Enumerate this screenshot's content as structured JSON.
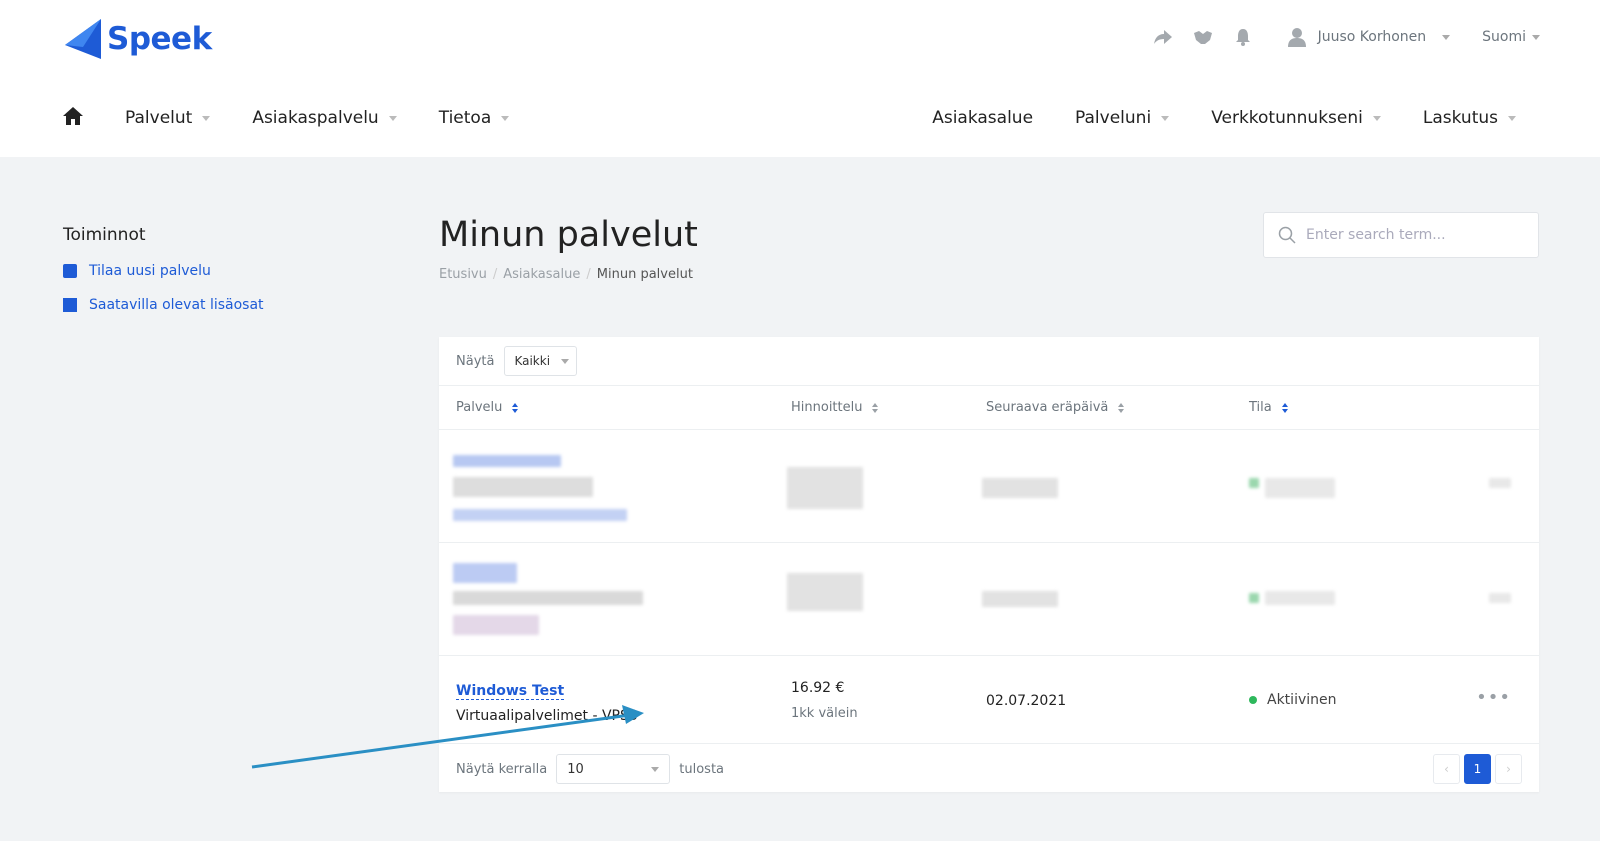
{
  "brand": {
    "name": "Speek",
    "color": "#1e5bd6"
  },
  "topbar": {
    "icons": [
      "share-icon",
      "handshake-icon",
      "bell-icon",
      "user-icon"
    ],
    "user_name": "Juuso Korhonen",
    "language": "Suomi"
  },
  "nav": {
    "left": [
      {
        "label": "Palvelut",
        "dropdown": true
      },
      {
        "label": "Asiakaspalvelu",
        "dropdown": true
      },
      {
        "label": "Tietoa",
        "dropdown": true
      }
    ],
    "right": [
      {
        "label": "Asiakasalue",
        "dropdown": false
      },
      {
        "label": "Palveluni",
        "dropdown": true
      },
      {
        "label": "Verkkotunnukseni",
        "dropdown": true
      },
      {
        "label": "Laskutus",
        "dropdown": true
      }
    ]
  },
  "sidebar": {
    "title": "Toiminnot",
    "links": [
      {
        "label": "Tilaa uusi palvelu",
        "icon": "cart-icon"
      },
      {
        "label": "Saatavilla olevat lisäosat",
        "icon": "addons-icon"
      }
    ]
  },
  "page": {
    "title": "Minun palvelut",
    "breadcrumb": [
      "Etusivu",
      "Asiakasalue",
      "Minun palvelut"
    ],
    "search_placeholder": "Enter search term..."
  },
  "table": {
    "show_label": "Näytä",
    "show_value": "Kaikki",
    "columns": [
      "Palvelu",
      "Hinnoittelu",
      "Seuraava eräpäivä",
      "Tila"
    ],
    "rows": [
      {
        "name": "Windows Test",
        "product": "Virtuaalipalvelimet - VPS3",
        "price": "16.92 €",
        "cycle": "1kk välein",
        "next_due": "02.07.2021",
        "status": "Aktiivinen",
        "actions": "•••"
      }
    ],
    "footer": {
      "per_page_label": "Näytä kerralla",
      "per_page_value": "10",
      "suffix": "tulosta",
      "pages": [
        "‹",
        "1",
        "›"
      ]
    }
  },
  "colors": {
    "accent": "#1e5bd6",
    "status_active": "#2eb85c",
    "annotation_arrow": "#2a8fc4"
  }
}
